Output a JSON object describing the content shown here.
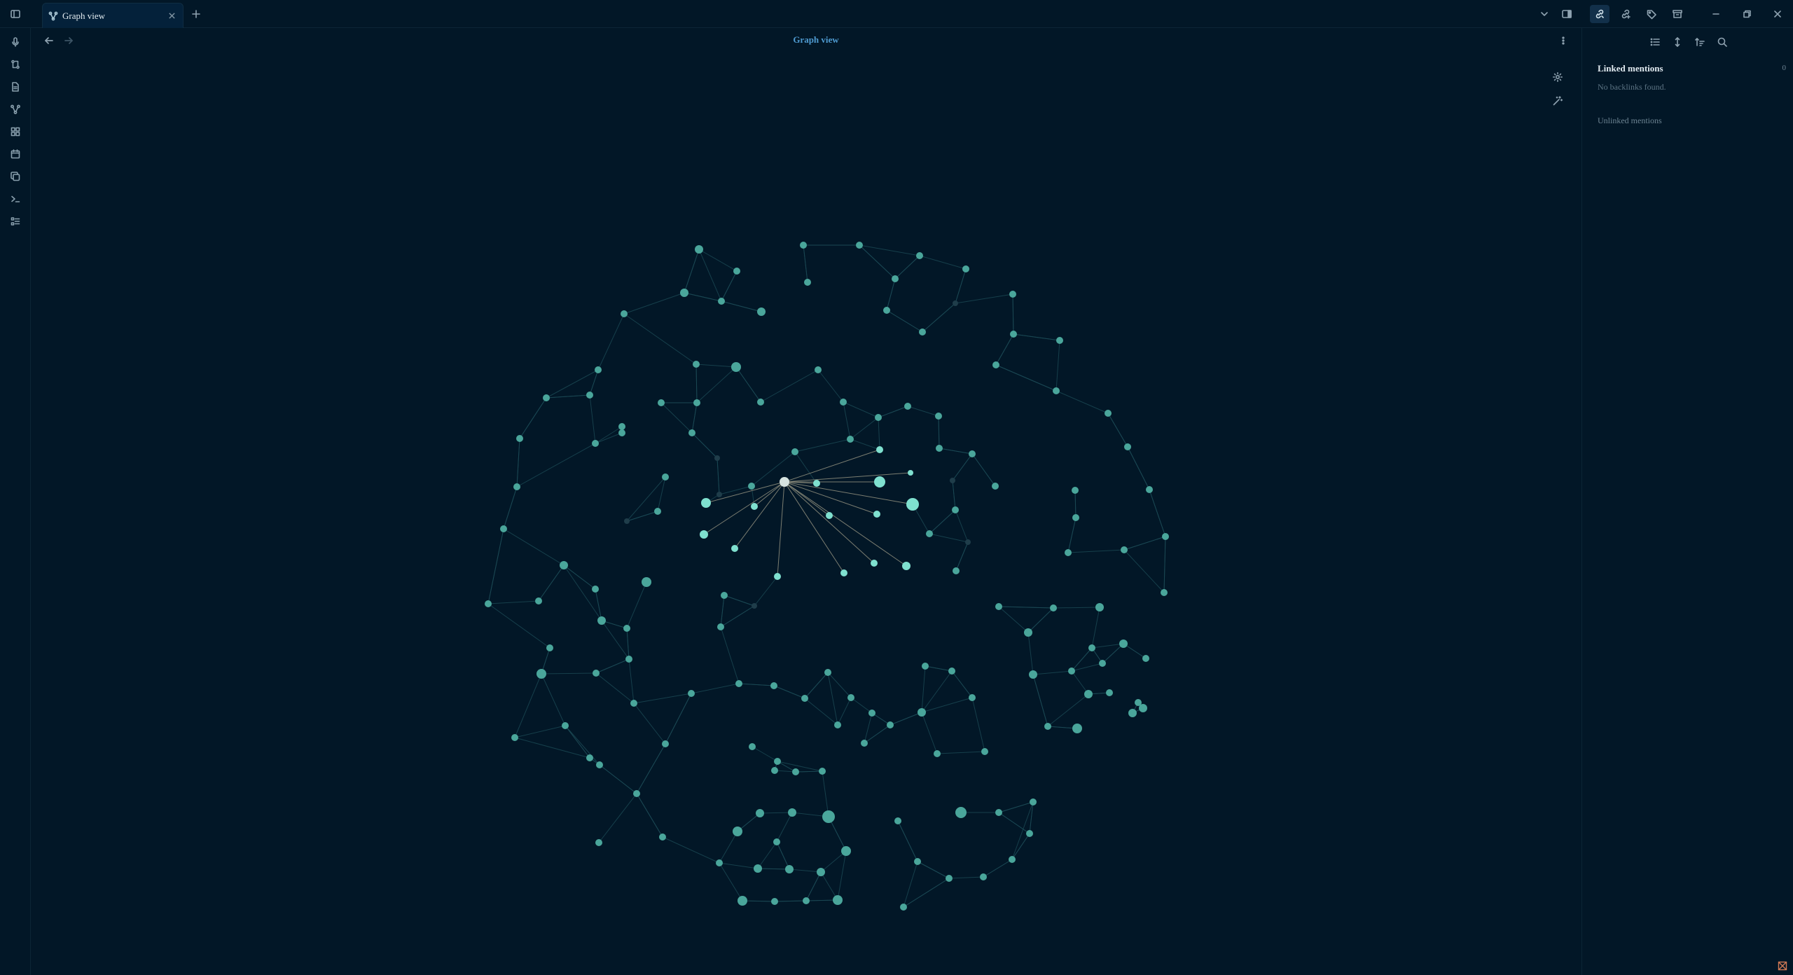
{
  "titlebar": {
    "tab": {
      "label": "Graph view",
      "icon": "graph-icon"
    },
    "buttons": [
      "sidebar-toggle-icon",
      "new-tab-icon",
      "tab-list-icon",
      "right-sidebar-icon",
      "backlinks-icon",
      "outgoing-links-icon",
      "tags-icon",
      "archive-icon",
      "minimize-icon",
      "restore-icon",
      "close-icon"
    ]
  },
  "ribbon": {
    "items": [
      "microphone-icon",
      "compare-icon",
      "new-note-icon",
      "graph-icon",
      "canvas-icon",
      "calendar-icon",
      "copy-icon",
      "terminal-icon",
      "checklist-icon"
    ]
  },
  "main": {
    "title": "Graph view"
  },
  "sidebar": {
    "linked_title": "Linked mentions",
    "linked_count": "0",
    "no_backlinks": "No backlinks found.",
    "unlinked_title": "Unlinked mentions"
  },
  "colors": {
    "background": "#021727",
    "node": "#4aa69b",
    "node_highlight": "#7fe0cf",
    "node_center": "#d7e3e0",
    "edge": "#1b4a55",
    "edge_highlight": "#8a8a7a",
    "title_accent": "#4e9ad0"
  }
}
